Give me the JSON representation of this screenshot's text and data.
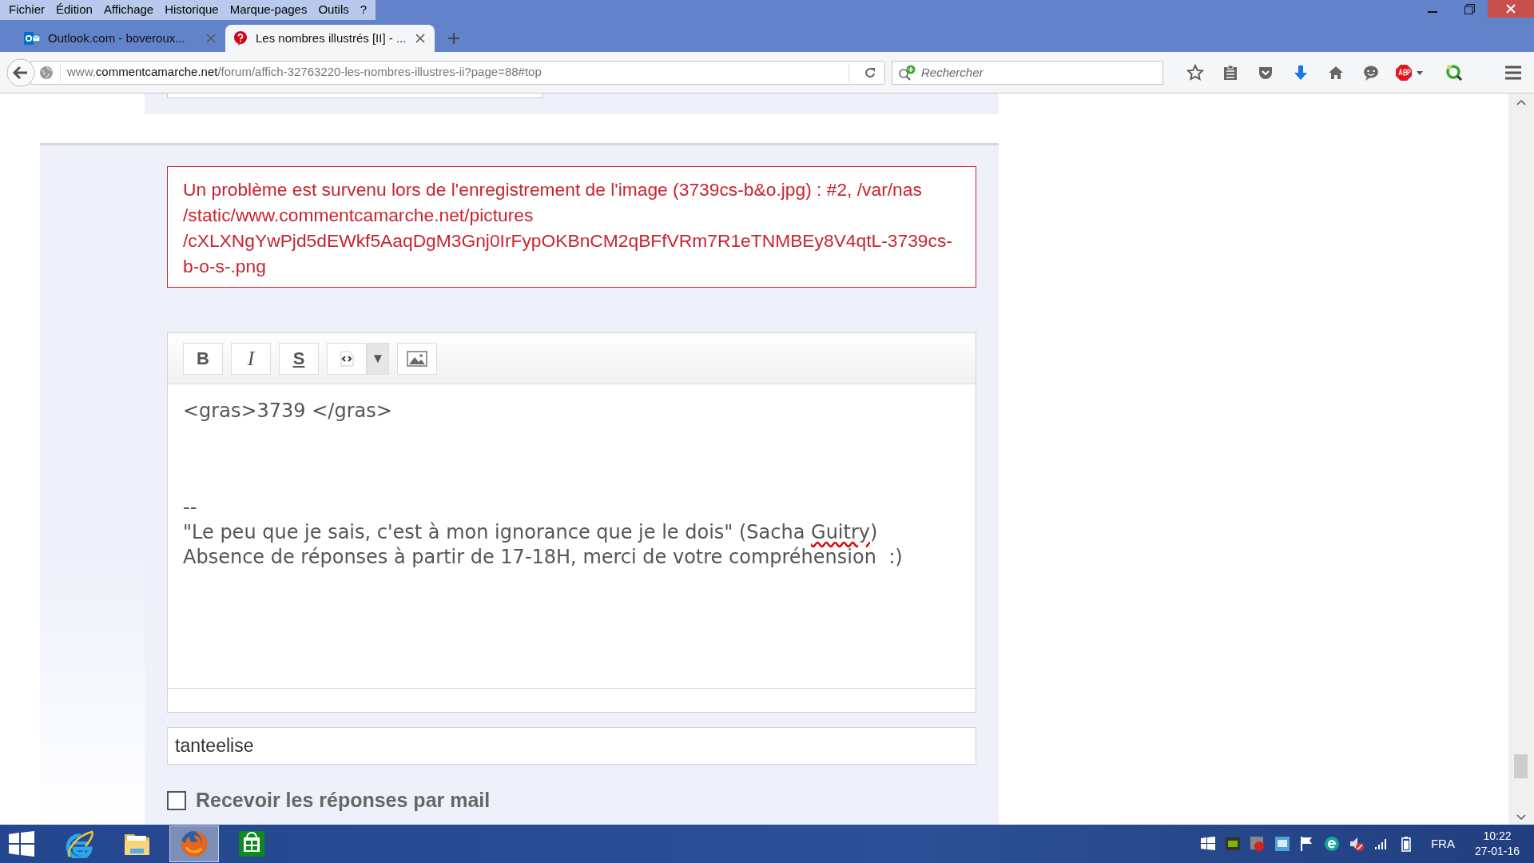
{
  "menu": [
    "Fichier",
    "Édition",
    "Affichage",
    "Historique",
    "Marque-pages",
    "Outils",
    "?"
  ],
  "tabs": [
    {
      "title": "Outlook.com - boveroux...",
      "kind": "outlook",
      "selected": false
    },
    {
      "title": "Les nombres illustrés [II] - ...",
      "kind": "ccm",
      "selected": true
    }
  ],
  "address": {
    "url": "www.**commentcamarche.net**/forum/affich-32763220-les-nombres-illustres-ii?page=88#top"
  },
  "search": {
    "placeholder": "Rechercher"
  },
  "error": {
    "lines": [
      "Un problème est survenu lors de l'enregistrement de l'image (3739cs-b&o.jpg) : #2, /var/nas",
      "/static/www.commentcamarche.net/pictures",
      "/cXLXNgYwPjd5dEWkf5AaqDgM3Gnj0IrFypOKBnCM2qBFfVRm7R1eTNMBEy8V4qtL-3739cs-",
      "b-o-s-.png"
    ]
  },
  "editor": {
    "toolbar": [
      {
        "kind": "bold",
        "label": "B"
      },
      {
        "kind": "italic",
        "label": "I"
      },
      {
        "kind": "strike",
        "label": "S"
      },
      {
        "kind": "code"
      },
      {
        "kind": "caret",
        "label": "▼"
      },
      {
        "kind": "image"
      }
    ],
    "body": "<gras>3739 </gras>",
    "signature": [
      {
        "segments": [
          {
            "text": "--"
          }
        ]
      },
      {
        "segments": [
          {
            "text": "\"Le peu que je sais, c'est à mon ignorance que je le dois\" (Sacha "
          },
          {
            "text": "Guitry",
            "misspelled": true
          },
          {
            "text": ")"
          }
        ]
      },
      {
        "segments": [
          {
            "text": "Absence de réponses à partir de 17-18H, merci de votre compréhension  :)"
          }
        ]
      }
    ]
  },
  "name_field": {
    "value": "tanteelise"
  },
  "mail_option": {
    "label": "Recevoir les réponses par mail",
    "checked": false
  },
  "taskbar": {
    "apps": [
      {
        "kind": "ie",
        "selected": false
      },
      {
        "kind": "folder",
        "selected": false
      },
      {
        "kind": "firefox",
        "selected": true
      },
      {
        "kind": "store",
        "selected": false
      }
    ],
    "language": "FRA",
    "time": "10:22",
    "date": "27-01-16"
  }
}
